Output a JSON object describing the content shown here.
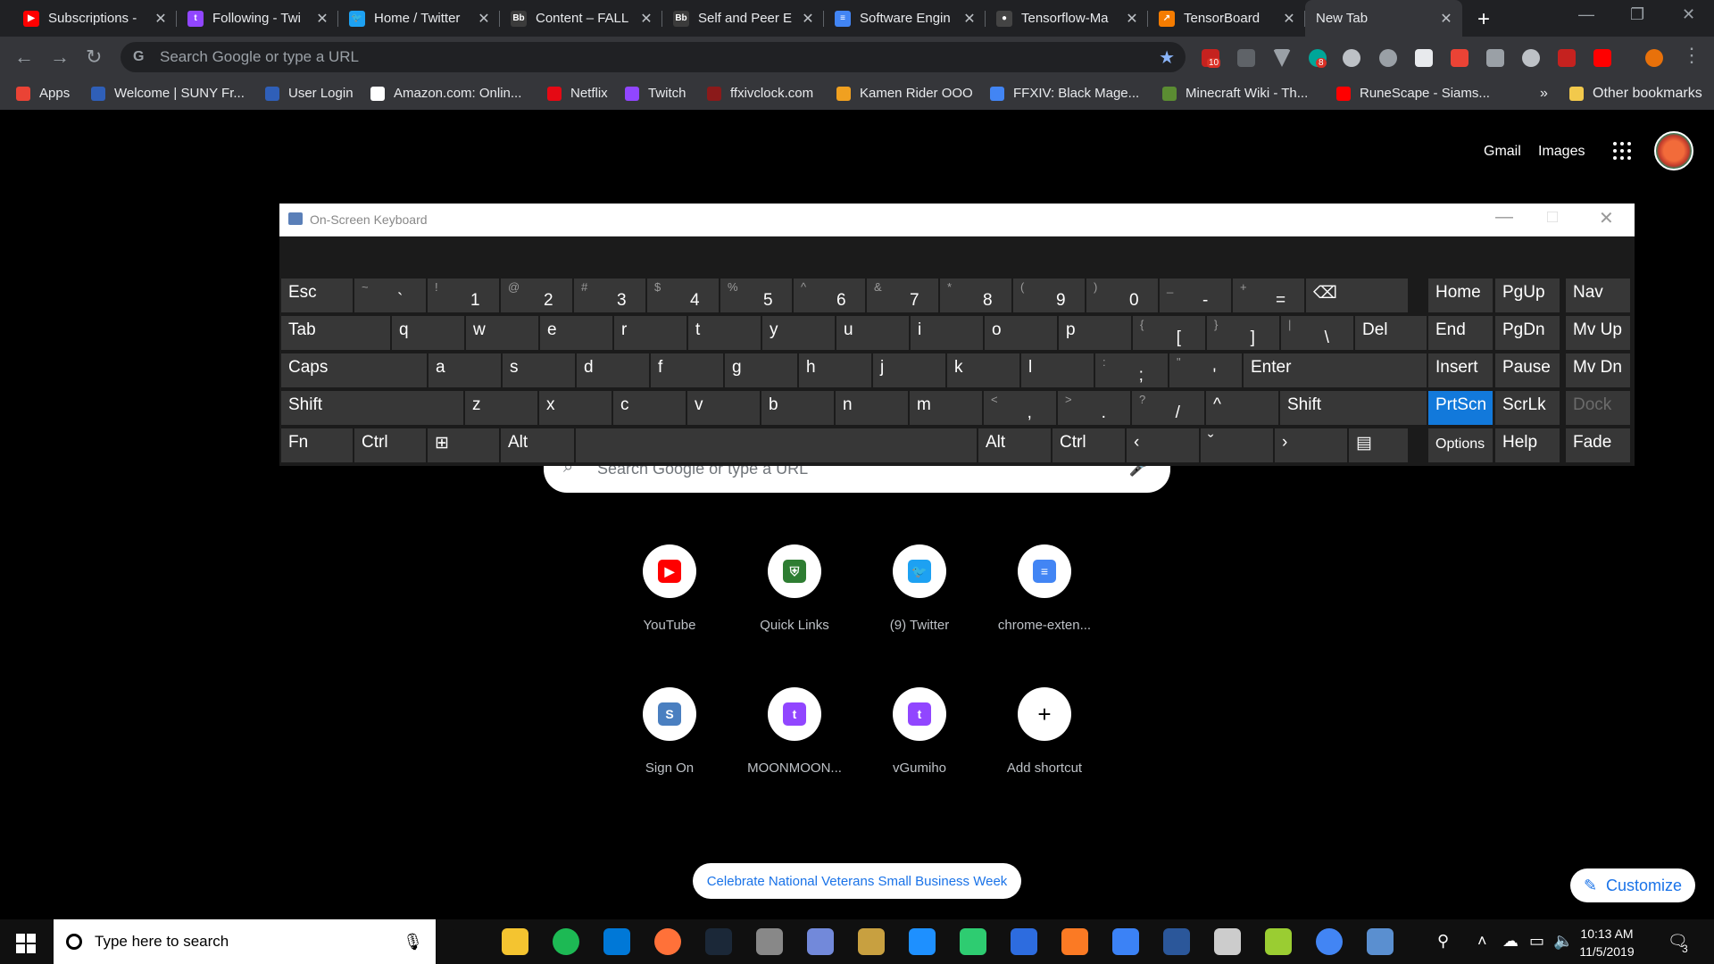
{
  "browser": {
    "tabs": [
      {
        "title": "Subscriptions -",
        "icon": "youtube-icon",
        "color": "#ff0000",
        "glyph": "▶"
      },
      {
        "title": "Following - Twi",
        "icon": "twitch-icon",
        "color": "#9146ff",
        "glyph": "t"
      },
      {
        "title": "Home / Twitter",
        "icon": "twitter-icon",
        "color": "#1da1f2",
        "glyph": "🐦"
      },
      {
        "title": "Content – FALL",
        "icon": "blackboard-icon",
        "color": "#3b3b3b",
        "glyph": "Bb"
      },
      {
        "title": "Self and Peer E",
        "icon": "blackboard-icon",
        "color": "#3b3b3b",
        "glyph": "Bb"
      },
      {
        "title": "Software Engin",
        "icon": "google-docs-icon",
        "color": "#4285f4",
        "glyph": "≡"
      },
      {
        "title": "Tensorflow-Ma",
        "icon": "github-icon",
        "color": "#444444",
        "glyph": "●"
      },
      {
        "title": "TensorBoard",
        "icon": "tensorboard-icon",
        "color": "#f57c00",
        "glyph": "↗"
      },
      {
        "title": "New Tab",
        "icon": "",
        "color": "",
        "glyph": ""
      }
    ],
    "omnibox_placeholder": "Search Google or type a URL",
    "bookmarks": [
      {
        "label": "Apps",
        "icon": "apps-icon",
        "color": "#ea4335"
      },
      {
        "label": "Welcome | SUNY Fr...",
        "icon": "suny-icon",
        "color": "#2f5fb8"
      },
      {
        "label": "User Login",
        "icon": "login-icon",
        "color": "#2f5fb8"
      },
      {
        "label": "Amazon.com: Onlin...",
        "icon": "amazon-icon",
        "color": "#ffffff"
      },
      {
        "label": "Netflix",
        "icon": "netflix-icon",
        "color": "#e50914"
      },
      {
        "label": "Twitch",
        "icon": "twitch-icon",
        "color": "#9146ff"
      },
      {
        "label": "ffxivclock.com",
        "icon": "ffxiv-icon",
        "color": "#8b1a1a"
      },
      {
        "label": "Kamen Rider OOO",
        "icon": "kamen-rider-icon",
        "color": "#f0a020"
      },
      {
        "label": "FFXIV: Black Mage...",
        "icon": "docs-icon",
        "color": "#4285f4"
      },
      {
        "label": "Minecraft Wiki - Th...",
        "icon": "minecraft-icon",
        "color": "#5b8c32"
      },
      {
        "label": "RuneScape - Siams...",
        "icon": "youtube-icon",
        "color": "#ff0000"
      }
    ],
    "bookmarks_overflow": "»",
    "other_bookmarks": "Other bookmarks",
    "extension_badges": {
      "gmail": "10",
      "ext2": "8"
    }
  },
  "ntp": {
    "gmail_link": "Gmail",
    "images_link": "Images",
    "search_placeholder": "Search Google or type a URL",
    "shortcuts": [
      {
        "label": "YouTube",
        "icon": "youtube-icon",
        "color": "#ff0000",
        "glyph": "▶"
      },
      {
        "label": "Quick Links",
        "icon": "shield-icon",
        "color": "#2e7d32",
        "glyph": "⛨"
      },
      {
        "label": "(9) Twitter",
        "icon": "twitter-icon",
        "color": "#1da1f2",
        "glyph": "🐦"
      },
      {
        "label": "chrome-exten...",
        "icon": "document-icon",
        "color": "#4285f4",
        "glyph": "≡"
      },
      {
        "label": "Sign On",
        "icon": "suny-icon",
        "color": "#4a7fc0",
        "glyph": "S"
      },
      {
        "label": "MOONMOON...",
        "icon": "twitch-icon",
        "color": "#9146ff",
        "glyph": "t"
      },
      {
        "label": "vGumiho",
        "icon": "twitch-icon",
        "color": "#9146ff",
        "glyph": "t"
      },
      {
        "label": "Add shortcut",
        "icon": "plus-icon",
        "color": "#000000",
        "glyph": "+"
      }
    ],
    "promo": "Celebrate National Veterans Small Business Week",
    "customize": "Customize"
  },
  "osk": {
    "title": "On-Screen Keyboard",
    "rows": [
      [
        {
          "m": "Esc",
          "u": "",
          "l": ""
        },
        {
          "m": "",
          "u": "~",
          "l": "`"
        },
        {
          "m": "",
          "u": "!",
          "l": "1"
        },
        {
          "m": "",
          "u": "@",
          "l": "2"
        },
        {
          "m": "",
          "u": "#",
          "l": "3"
        },
        {
          "m": "",
          "u": "$",
          "l": "4"
        },
        {
          "m": "",
          "u": "%",
          "l": "5"
        },
        {
          "m": "",
          "u": "^",
          "l": "6"
        },
        {
          "m": "",
          "u": "&",
          "l": "7"
        },
        {
          "m": "",
          "u": "*",
          "l": "8"
        },
        {
          "m": "",
          "u": "(",
          "l": "9"
        },
        {
          "m": "",
          "u": ")",
          "l": "0"
        },
        {
          "m": "",
          "u": "_",
          "l": "-"
        },
        {
          "m": "",
          "u": "+",
          "l": "="
        },
        {
          "m": "⌫",
          "u": "",
          "l": ""
        }
      ],
      [
        {
          "m": "Tab",
          "u": "",
          "l": ""
        },
        {
          "m": "q",
          "u": "",
          "l": ""
        },
        {
          "m": "w",
          "u": "",
          "l": ""
        },
        {
          "m": "e",
          "u": "",
          "l": ""
        },
        {
          "m": "r",
          "u": "",
          "l": ""
        },
        {
          "m": "t",
          "u": "",
          "l": ""
        },
        {
          "m": "y",
          "u": "",
          "l": ""
        },
        {
          "m": "u",
          "u": "",
          "l": ""
        },
        {
          "m": "i",
          "u": "",
          "l": ""
        },
        {
          "m": "o",
          "u": "",
          "l": ""
        },
        {
          "m": "p",
          "u": "",
          "l": ""
        },
        {
          "m": "",
          "u": "{",
          "l": "["
        },
        {
          "m": "",
          "u": "}",
          "l": "]"
        },
        {
          "m": "",
          "u": "|",
          "l": "\\"
        },
        {
          "m": "Del",
          "u": "",
          "l": ""
        }
      ],
      [
        {
          "m": "Caps",
          "u": "",
          "l": ""
        },
        {
          "m": "a",
          "u": "",
          "l": ""
        },
        {
          "m": "s",
          "u": "",
          "l": ""
        },
        {
          "m": "d",
          "u": "",
          "l": ""
        },
        {
          "m": "f",
          "u": "",
          "l": ""
        },
        {
          "m": "g",
          "u": "",
          "l": ""
        },
        {
          "m": "h",
          "u": "",
          "l": ""
        },
        {
          "m": "j",
          "u": "",
          "l": ""
        },
        {
          "m": "k",
          "u": "",
          "l": ""
        },
        {
          "m": "l",
          "u": "",
          "l": ""
        },
        {
          "m": "",
          "u": ":",
          "l": ";"
        },
        {
          "m": "",
          "u": "\"",
          "l": "'"
        },
        {
          "m": "Enter",
          "u": "",
          "l": ""
        }
      ],
      [
        {
          "m": "Shift",
          "u": "",
          "l": ""
        },
        {
          "m": "z",
          "u": "",
          "l": ""
        },
        {
          "m": "x",
          "u": "",
          "l": ""
        },
        {
          "m": "c",
          "u": "",
          "l": ""
        },
        {
          "m": "v",
          "u": "",
          "l": ""
        },
        {
          "m": "b",
          "u": "",
          "l": ""
        },
        {
          "m": "n",
          "u": "",
          "l": ""
        },
        {
          "m": "m",
          "u": "",
          "l": ""
        },
        {
          "m": "",
          "u": "<",
          "l": ","
        },
        {
          "m": "",
          "u": ">",
          "l": "."
        },
        {
          "m": "",
          "u": "?",
          "l": "/"
        },
        {
          "m": "^",
          "u": "",
          "l": ""
        },
        {
          "m": "Shift",
          "u": "",
          "l": ""
        }
      ],
      [
        {
          "m": "Fn",
          "u": "",
          "l": ""
        },
        {
          "m": "Ctrl",
          "u": "",
          "l": ""
        },
        {
          "m": "⊞",
          "u": "",
          "l": ""
        },
        {
          "m": "Alt",
          "u": "",
          "l": ""
        },
        {
          "m": "",
          "u": "",
          "l": ""
        },
        {
          "m": "Alt",
          "u": "",
          "l": ""
        },
        {
          "m": "Ctrl",
          "u": "",
          "l": ""
        },
        {
          "m": "‹",
          "u": "",
          "l": ""
        },
        {
          "m": "ˇ",
          "u": "",
          "l": ""
        },
        {
          "m": "›",
          "u": "",
          "l": ""
        },
        {
          "m": "▤",
          "u": "",
          "l": ""
        }
      ]
    ],
    "nav": [
      [
        "Home",
        "PgUp",
        "Nav"
      ],
      [
        "End",
        "PgDn",
        "Mv Up"
      ],
      [
        "Insert",
        "Pause",
        "Mv Dn"
      ],
      [
        "PrtScn",
        "ScrLk",
        "Dock"
      ],
      [
        "Options",
        "Help",
        "Fade"
      ]
    ],
    "highlighted": "PrtScn",
    "dimmed": "Dock"
  },
  "taskbar": {
    "search_placeholder": "Type here to search",
    "time": "10:13 AM",
    "date": "11/5/2019",
    "notification_count": "3",
    "apps": [
      {
        "icon": "task-view-icon",
        "color": "#101010"
      },
      {
        "icon": "file-explorer-icon",
        "color": "#f4c430"
      },
      {
        "icon": "spotify-icon",
        "color": "#1db954"
      },
      {
        "icon": "edge-icon",
        "color": "#0078d7"
      },
      {
        "icon": "firefox-icon",
        "color": "#ff7139"
      },
      {
        "icon": "steam-icon",
        "color": "#1b2838"
      },
      {
        "icon": "app-icon",
        "color": "#888888"
      },
      {
        "icon": "discord-icon",
        "color": "#7289da"
      },
      {
        "icon": "app-icon",
        "color": "#c8a040"
      },
      {
        "icon": "visual-studio-icon",
        "color": "#1e90ff"
      },
      {
        "icon": "app-icon",
        "color": "#2ecc71"
      },
      {
        "icon": "app-icon",
        "color": "#2d6cdf"
      },
      {
        "icon": "xampp-icon",
        "color": "#fb7a24"
      },
      {
        "icon": "app-icon",
        "color": "#3b82f6"
      },
      {
        "icon": "word-icon",
        "color": "#2b579a"
      },
      {
        "icon": "paint-icon",
        "color": "#cccccc"
      },
      {
        "icon": "app-icon",
        "color": "#9acd32"
      },
      {
        "icon": "chrome-icon",
        "color": "#4285f4"
      },
      {
        "icon": "remote-desktop-icon",
        "color": "#5a8fd0"
      }
    ]
  }
}
